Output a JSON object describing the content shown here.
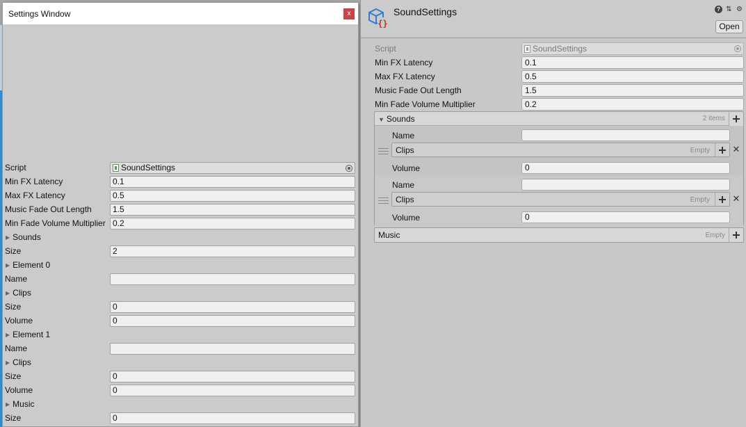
{
  "settings_window": {
    "title": "Settings Window",
    "close_glyph": "x",
    "rows": [
      {
        "kind": "object",
        "label": "Script",
        "value": "SoundSettings"
      },
      {
        "kind": "field",
        "label": "Min FX Latency",
        "value": "0.1"
      },
      {
        "kind": "field",
        "label": "Max FX Latency",
        "value": "0.5"
      },
      {
        "kind": "field",
        "label": "Music Fade Out Length",
        "value": "1.5"
      },
      {
        "kind": "field",
        "label": "Min Fade Volume Multiplier",
        "value": "0.2"
      },
      {
        "kind": "foldout",
        "label": "Sounds"
      },
      {
        "kind": "field",
        "label": "Size",
        "value": "2"
      },
      {
        "kind": "foldout",
        "label": "Element 0"
      },
      {
        "kind": "field",
        "label": "Name",
        "value": ""
      },
      {
        "kind": "foldout",
        "label": "Clips"
      },
      {
        "kind": "field",
        "label": "Size",
        "value": "0"
      },
      {
        "kind": "field",
        "label": "Volume",
        "value": "0"
      },
      {
        "kind": "foldout",
        "label": "Element 1"
      },
      {
        "kind": "field",
        "label": "Name",
        "value": ""
      },
      {
        "kind": "foldout",
        "label": "Clips"
      },
      {
        "kind": "field",
        "label": "Size",
        "value": "0"
      },
      {
        "kind": "field",
        "label": "Volume",
        "value": "0"
      },
      {
        "kind": "foldout",
        "label": "Music"
      },
      {
        "kind": "field",
        "label": "Size",
        "value": "0"
      }
    ]
  },
  "inspector": {
    "title": "SoundSettings",
    "open_label": "Open",
    "header_icons": [
      "help-icon",
      "presets-icon",
      "gear-icon"
    ],
    "script": {
      "label": "Script",
      "value": "SoundSettings"
    },
    "fields": [
      {
        "label": "Min FX Latency",
        "value": "0.1"
      },
      {
        "label": "Max FX Latency",
        "value": "0.5"
      },
      {
        "label": "Music Fade Out Length",
        "value": "1.5"
      },
      {
        "label": "Min Fade Volume Multiplier",
        "value": "0.2"
      }
    ],
    "sounds": {
      "title": "Sounds",
      "count": "2 items",
      "elements": [
        {
          "name_label": "Name",
          "name_value": "",
          "clips_label": "Clips",
          "clips_empty": "Empty",
          "volume_label": "Volume",
          "volume_value": "0"
        },
        {
          "name_label": "Name",
          "name_value": "",
          "clips_label": "Clips",
          "clips_empty": "Empty",
          "volume_label": "Volume",
          "volume_value": "0"
        }
      ]
    },
    "music": {
      "title": "Music",
      "empty": "Empty"
    }
  },
  "colors": {
    "close_button": "#c94444",
    "asset_icon_blue": "#2f7fd0",
    "asset_icon_red": "#c0302a"
  }
}
